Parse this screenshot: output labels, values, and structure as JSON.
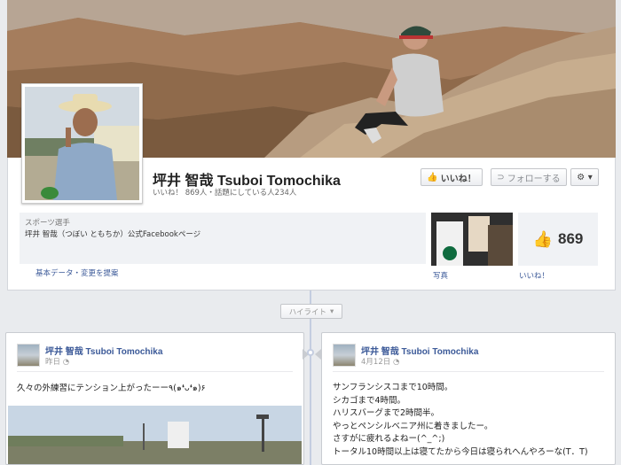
{
  "page": {
    "name": "坪井 智哉 Tsuboi Tomochika",
    "likes_line": "いいね！ 869人・話題にしている人234人"
  },
  "actions": {
    "like_label": "いいね！",
    "follow_label": "フォローする",
    "gear_label": "⚙ ▾"
  },
  "about": {
    "category": "スポーツ選手",
    "description": "坪井 智哉（つぼい ともちか）公式Facebookページ",
    "basic_data_link": "基本データ・変更を提案"
  },
  "tiles": {
    "photos_label": "写真",
    "like_count": "869",
    "likes_label": "いいね！"
  },
  "timeline": {
    "highlight_label": "ハイライト"
  },
  "posts": [
    {
      "author": "坪井 智哉 Tsuboi Tomochika",
      "date": "昨日",
      "text": "久々の外練習にテンション上がったーー٩(๑❛ᴗ❛๑)۶"
    },
    {
      "author": "坪井 智哉 Tsuboi Tomochika",
      "date": "4月12日",
      "text": "サンフランシスコまで10時間。\nシカゴまで4時間。\nハリスバーグまで2時間半。\nやっとペンシルベニア州に着きましたー。\nさすがに疲れるよねー(^_^;)\nトータル10時間以上は寝てたから今日は寝られへんやろーな(T．T)"
    }
  ],
  "colors": {
    "link": "#3b5998",
    "background": "#e9ebee"
  }
}
